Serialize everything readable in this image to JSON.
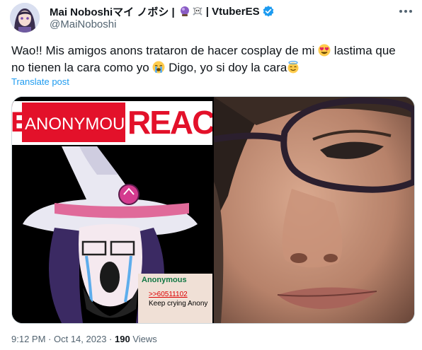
{
  "author": {
    "display_name": "Mai Noboshiマイ ノボシ | ",
    "name_suffix": "| VtuberES",
    "handle": "@MaiNoboshi"
  },
  "tweet": {
    "line1_a": "Wao!! Mis amigos anons trataron de hacer cosplay de mi ",
    "line1_b": " lastima que",
    "line2_a": "no tienen la cara como yo ",
    "line2_b": " Digo, yo si doy la cara",
    "translate_label": "Translate post"
  },
  "media": {
    "banner_word1": "ANONYMOUS",
    "banner_word2": "REACTI",
    "banner_left_letter": "E",
    "comment_name": "Anonymous",
    "comment_link": ">>60511102",
    "comment_text": "Keep crying Anony"
  },
  "footer": {
    "time": "9:12 PM",
    "sep1": " · ",
    "date": "Oct 14, 2023",
    "sep2": " · ",
    "views_count": "190",
    "views_label": " Views"
  },
  "colors": {
    "verified_blue": "#1d9bf0",
    "banner_red": "#e3112a",
    "link_blue": "#1d9bf0",
    "comment_green": "#117743"
  }
}
